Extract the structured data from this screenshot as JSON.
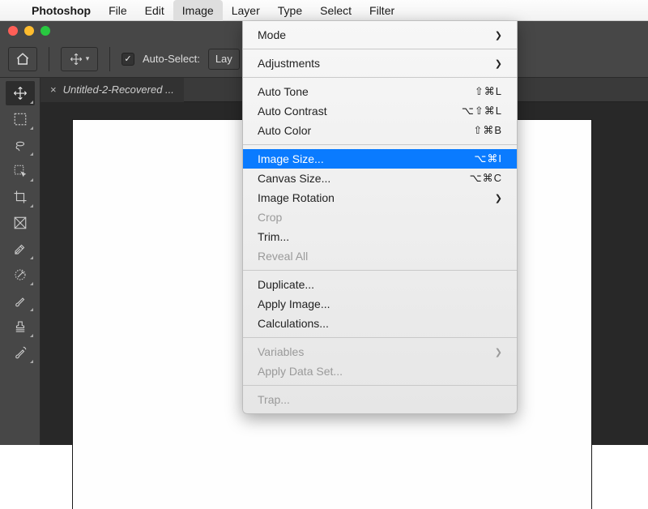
{
  "menubar": {
    "app_name": "Photoshop",
    "items": [
      "File",
      "Edit",
      "Image",
      "Layer",
      "Type",
      "Select",
      "Filter"
    ],
    "active_index": 2
  },
  "options": {
    "auto_select_label": "Auto-Select:",
    "auto_select_value": "Lay"
  },
  "doc": {
    "tab_title": "Untitled-2-Recovered ..."
  },
  "dropdown": {
    "groups": [
      [
        {
          "label": "Mode",
          "shortcut": "",
          "submenu": true,
          "disabled": false
        },
        {
          "label": "Adjustments",
          "shortcut": "",
          "submenu": true,
          "disabled": false
        }
      ],
      [
        {
          "label": "Auto Tone",
          "shortcut": "⇧⌘L",
          "submenu": false,
          "disabled": false
        },
        {
          "label": "Auto Contrast",
          "shortcut": "⌥⇧⌘L",
          "submenu": false,
          "disabled": false
        },
        {
          "label": "Auto Color",
          "shortcut": "⇧⌘B",
          "submenu": false,
          "disabled": false
        }
      ],
      [
        {
          "label": "Image Size...",
          "shortcut": "⌥⌘I",
          "submenu": false,
          "disabled": false,
          "selected": true
        },
        {
          "label": "Canvas Size...",
          "shortcut": "⌥⌘C",
          "submenu": false,
          "disabled": false
        },
        {
          "label": "Image Rotation",
          "shortcut": "",
          "submenu": true,
          "disabled": false
        },
        {
          "label": "Crop",
          "shortcut": "",
          "submenu": false,
          "disabled": true
        },
        {
          "label": "Trim...",
          "shortcut": "",
          "submenu": false,
          "disabled": false
        },
        {
          "label": "Reveal All",
          "shortcut": "",
          "submenu": false,
          "disabled": true
        }
      ],
      [
        {
          "label": "Duplicate...",
          "shortcut": "",
          "submenu": false,
          "disabled": false
        },
        {
          "label": "Apply Image...",
          "shortcut": "",
          "submenu": false,
          "disabled": false
        },
        {
          "label": "Calculations...",
          "shortcut": "",
          "submenu": false,
          "disabled": false
        }
      ],
      [
        {
          "label": "Variables",
          "shortcut": "",
          "submenu": true,
          "disabled": true
        },
        {
          "label": "Apply Data Set...",
          "shortcut": "",
          "submenu": false,
          "disabled": true
        }
      ],
      [
        {
          "label": "Trap...",
          "shortcut": "",
          "submenu": false,
          "disabled": true
        }
      ]
    ]
  },
  "tools": [
    {
      "name": "move-tool",
      "selected": true
    },
    {
      "name": "marquee-tool"
    },
    {
      "name": "lasso-tool"
    },
    {
      "name": "quick-select-tool"
    },
    {
      "name": "crop-tool"
    },
    {
      "name": "frame-tool"
    },
    {
      "name": "eyedropper-tool"
    },
    {
      "name": "healing-brush-tool"
    },
    {
      "name": "brush-tool"
    },
    {
      "name": "stamp-tool"
    },
    {
      "name": "history-brush-tool"
    }
  ]
}
